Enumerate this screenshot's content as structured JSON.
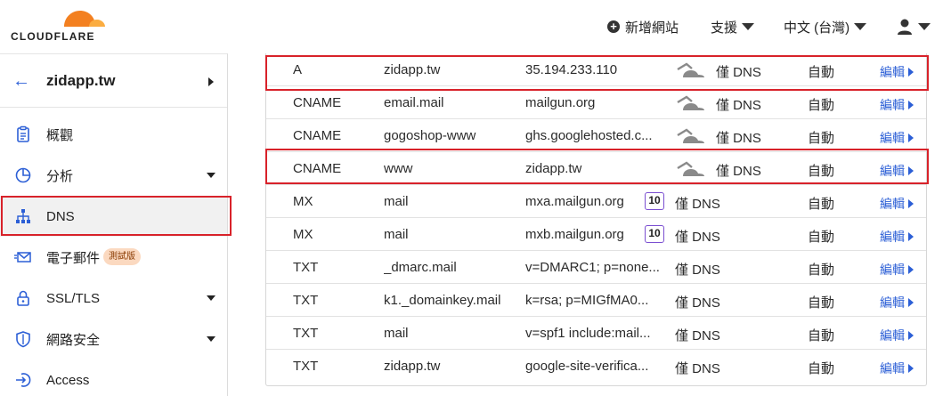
{
  "brand": {
    "logo_text": "CLOUDFLARE",
    "accent": "#f38020"
  },
  "header": {
    "add_site": "新增網站",
    "support": "支援",
    "language": "中文 (台灣)"
  },
  "sidebar": {
    "site_name": "zidapp.tw",
    "items": [
      {
        "label": "概觀",
        "icon": "clipboard-icon",
        "has_caret": false
      },
      {
        "label": "分析",
        "icon": "pie-chart-icon",
        "has_caret": true
      },
      {
        "label": "DNS",
        "icon": "network-icon",
        "has_caret": false,
        "active": true
      },
      {
        "label": "電子郵件",
        "icon": "email-icon",
        "has_caret": false,
        "badge": "測試版"
      },
      {
        "label": "SSL/TLS",
        "icon": "lock-icon",
        "has_caret": true
      },
      {
        "label": "網路安全",
        "icon": "shield-icon",
        "has_caret": true
      },
      {
        "label": "Access",
        "icon": "access-icon",
        "has_caret": false
      }
    ]
  },
  "dns_table": {
    "edit_label": "編輯",
    "rows": [
      {
        "type": "A",
        "name": "zidapp.tw",
        "content": "35.194.233.110",
        "proxy_icon": "cloud-dns-only-icon",
        "status": "僅 DNS",
        "ttl": "自動"
      },
      {
        "type": "CNAME",
        "name": "email.mail",
        "content": "mailgun.org",
        "proxy_icon": "cloud-dns-only-icon",
        "status": "僅 DNS",
        "ttl": "自動"
      },
      {
        "type": "CNAME",
        "name": "gogoshop-www",
        "content": "ghs.googlehosted.c...",
        "proxy_icon": "cloud-dns-only-icon",
        "status": "僅 DNS",
        "ttl": "自動"
      },
      {
        "type": "CNAME",
        "name": "www",
        "content": "zidapp.tw",
        "proxy_icon": "cloud-dns-only-icon",
        "status": "僅 DNS",
        "ttl": "自動"
      },
      {
        "type": "MX",
        "name": "mail",
        "content": "mxa.mailgun.org",
        "priority": "10",
        "status": "僅 DNS",
        "ttl": "自動"
      },
      {
        "type": "MX",
        "name": "mail",
        "content": "mxb.mailgun.org",
        "priority": "10",
        "status": "僅 DNS",
        "ttl": "自動"
      },
      {
        "type": "TXT",
        "name": "_dmarc.mail",
        "content": "v=DMARC1; p=none...",
        "status": "僅 DNS",
        "ttl": "自動"
      },
      {
        "type": "TXT",
        "name": "k1._domainkey.mail",
        "content": "k=rsa; p=MIGfMA0...",
        "status": "僅 DNS",
        "ttl": "自動"
      },
      {
        "type": "TXT",
        "name": "mail",
        "content": "v=spf1 include:mail...",
        "status": "僅 DNS",
        "ttl": "自動"
      },
      {
        "type": "TXT",
        "name": "zidapp.tw",
        "content": "google-site-verifica...",
        "status": "僅 DNS",
        "ttl": "自動"
      }
    ]
  },
  "highlight_color": "#d8222a"
}
